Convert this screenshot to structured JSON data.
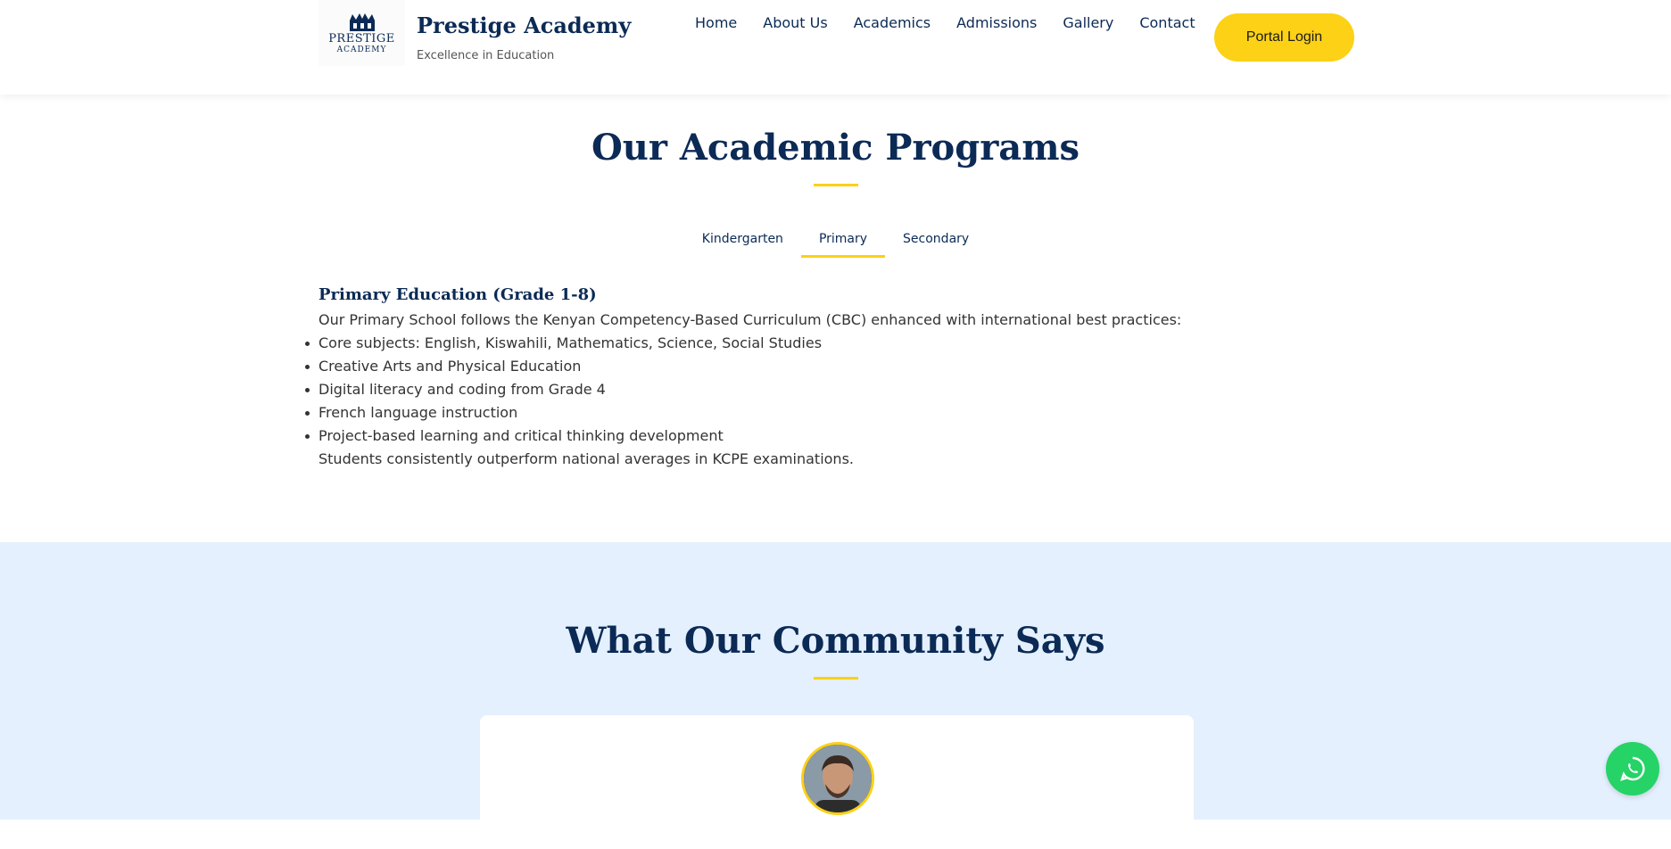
{
  "header": {
    "logo": {
      "word1": "PRESTIGE",
      "word2": "ACADEMY"
    },
    "brand_name": "Prestige Academy",
    "tagline": "Excellence in Education",
    "nav": [
      "Home",
      "About Us",
      "Academics",
      "Admissions",
      "Gallery",
      "Contact"
    ],
    "portal_button": "Portal Login"
  },
  "programs": {
    "title": "Our Academic Programs",
    "tabs": [
      "Kindergarten",
      "Primary",
      "Secondary"
    ],
    "active_tab": "Primary",
    "heading": "Primary Education (Grade 1-8)",
    "intro": "Our Primary School follows the Kenyan Competency-Based Curriculum (CBC) enhanced with international best practices:",
    "bullets": [
      "Core subjects: English, Kiswahili, Mathematics, Science, Social Studies",
      "Creative Arts and Physical Education",
      "Digital literacy and coding from Grade 4",
      "French language instruction",
      "Project-based learning and critical thinking development"
    ],
    "closing": "Students consistently outperform national averages in KCPE examinations."
  },
  "community": {
    "title": "What Our Community Says"
  },
  "colors": {
    "navy": "#0b2a55",
    "accent_yellow": "#fcd116",
    "community_bg": "#e4f0fd",
    "whatsapp_green": "#25d366"
  },
  "icons": {
    "logo": "crown-crest-icon",
    "chat": "whatsapp-icon"
  }
}
